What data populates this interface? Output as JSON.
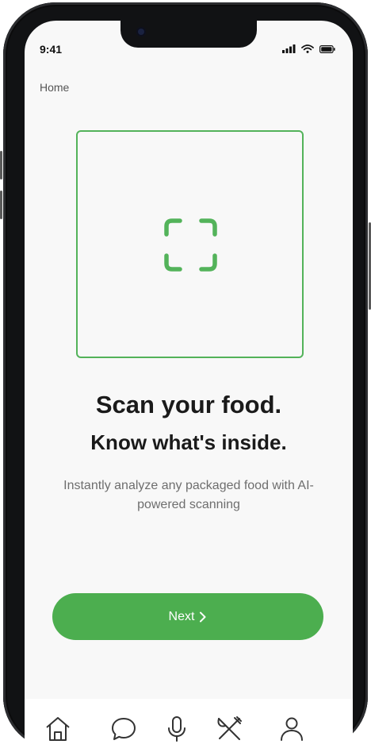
{
  "status_bar": {
    "time": "9:41",
    "icons": [
      "cellular-signal-icon",
      "wifi-icon",
      "battery-icon"
    ]
  },
  "header": {
    "breadcrumb": "Home"
  },
  "scanner": {
    "icon": "scan-frame-icon",
    "accent_color": "#4cae4f"
  },
  "hero": {
    "title_line1": "Scan your food.",
    "title_line2": "Know what's inside.",
    "description": "Instantly analyze any packaged food with AI-powered scanning"
  },
  "primary_action": {
    "label": "Next",
    "icon": "chevron-right-icon"
  },
  "bottom_nav": {
    "items": [
      {
        "name": "home",
        "icon": "home-icon"
      },
      {
        "name": "chat",
        "icon": "chat-bubble-icon"
      },
      {
        "name": "voice",
        "icon": "microphone-icon"
      },
      {
        "name": "food",
        "icon": "fork-knife-icon"
      },
      {
        "name": "profile",
        "icon": "user-icon"
      }
    ]
  }
}
